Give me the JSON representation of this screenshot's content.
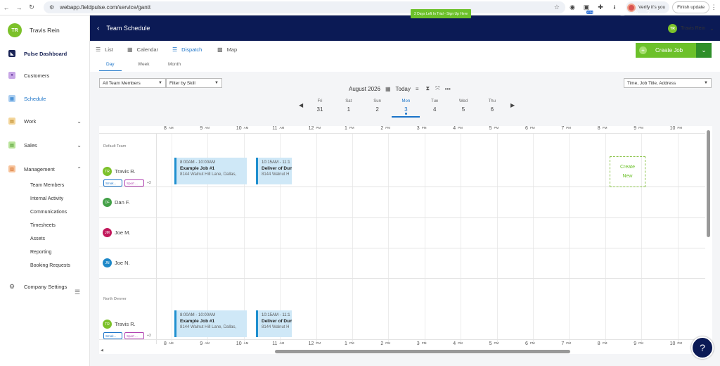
{
  "browser": {
    "url": "webapp.fieldpulse.com/service/gantt",
    "ext_badge": "0.54",
    "verify_label": "Verify it's you",
    "finish_label": "Finish update"
  },
  "sidebar": {
    "user_initials": "TR",
    "user_name": "Travis Rein",
    "items": [
      {
        "label": "Pulse Dashboard"
      },
      {
        "label": "Customers"
      },
      {
        "label": "Schedule"
      },
      {
        "label": "Work"
      },
      {
        "label": "Sales"
      },
      {
        "label": "Management"
      }
    ],
    "management_sub": [
      "Team Members",
      "Internal Activity",
      "Communications",
      "Timesheets",
      "Assets",
      "Reporting",
      "Booking Requests"
    ],
    "company_settings": "Company Settings"
  },
  "topbar": {
    "title": "Team Schedule",
    "trial": "2 Days Left In Trial - Sign Up Here",
    "user_initials": "TR",
    "user_name": "Travis Rein"
  },
  "views": {
    "list": "List",
    "calendar": "Calendar",
    "dispatch": "Dispatch",
    "map": "Map"
  },
  "subtabs": {
    "day": "Day",
    "week": "Week",
    "month": "Month"
  },
  "create_job": "Create Job",
  "filters": {
    "members": "All Team Members",
    "skill": "Filter by Skill",
    "search": "Time, Job Title, Address"
  },
  "date": {
    "label": "August 2026",
    "today": "Today"
  },
  "days": [
    {
      "name": "Fri",
      "num": "31"
    },
    {
      "name": "Sat",
      "num": "1"
    },
    {
      "name": "Sun",
      "num": "2"
    },
    {
      "name": "Mon",
      "num": "3"
    },
    {
      "name": "Tue",
      "num": "4"
    },
    {
      "name": "Wed",
      "num": "5"
    },
    {
      "name": "Thu",
      "num": "6"
    }
  ],
  "hours": [
    {
      "h": "8",
      "p": "AM"
    },
    {
      "h": "9",
      "p": "AM"
    },
    {
      "h": "10",
      "p": "AM"
    },
    {
      "h": "11",
      "p": "AM"
    },
    {
      "h": "12",
      "p": "PM"
    },
    {
      "h": "1",
      "p": "PM"
    },
    {
      "h": "2",
      "p": "PM"
    },
    {
      "h": "3",
      "p": "PM"
    },
    {
      "h": "4",
      "p": "PM"
    },
    {
      "h": "5",
      "p": "PM"
    },
    {
      "h": "6",
      "p": "PM"
    },
    {
      "h": "7",
      "p": "PM"
    },
    {
      "h": "8",
      "p": "PM"
    },
    {
      "h": "9",
      "p": "PM"
    },
    {
      "h": "10",
      "p": "PM"
    }
  ],
  "teams": {
    "default": "Default Team",
    "north": "North Denver"
  },
  "members": [
    {
      "initials": "TR",
      "name": "Travis R.",
      "color": "#7cc12a"
    },
    {
      "initials": "DF",
      "name": "Dan F.",
      "color": "#43a047"
    },
    {
      "initials": "JM",
      "name": "Joe M.",
      "color": "#c2185b"
    },
    {
      "initials": "JN",
      "name": "Joe N.",
      "color": "#1e88c8"
    },
    {
      "initials": "TR",
      "name": "Travis R.",
      "color": "#7cc12a"
    }
  ],
  "tags": {
    "smoke": "Smok...",
    "sport": "Sport ...",
    "more": "+3"
  },
  "jobs": {
    "a": {
      "time": "8:00AM - 10:00AM",
      "name": "Example Job #1",
      "addr": "8144 Walnut Hill Lane, Dallas,"
    },
    "b": {
      "time": "10:15AM - 11:1",
      "name": "Deliver of Dun",
      "addr": "8144 Walnut H"
    }
  },
  "create_new": {
    "l1": "Create",
    "l2": "New"
  }
}
